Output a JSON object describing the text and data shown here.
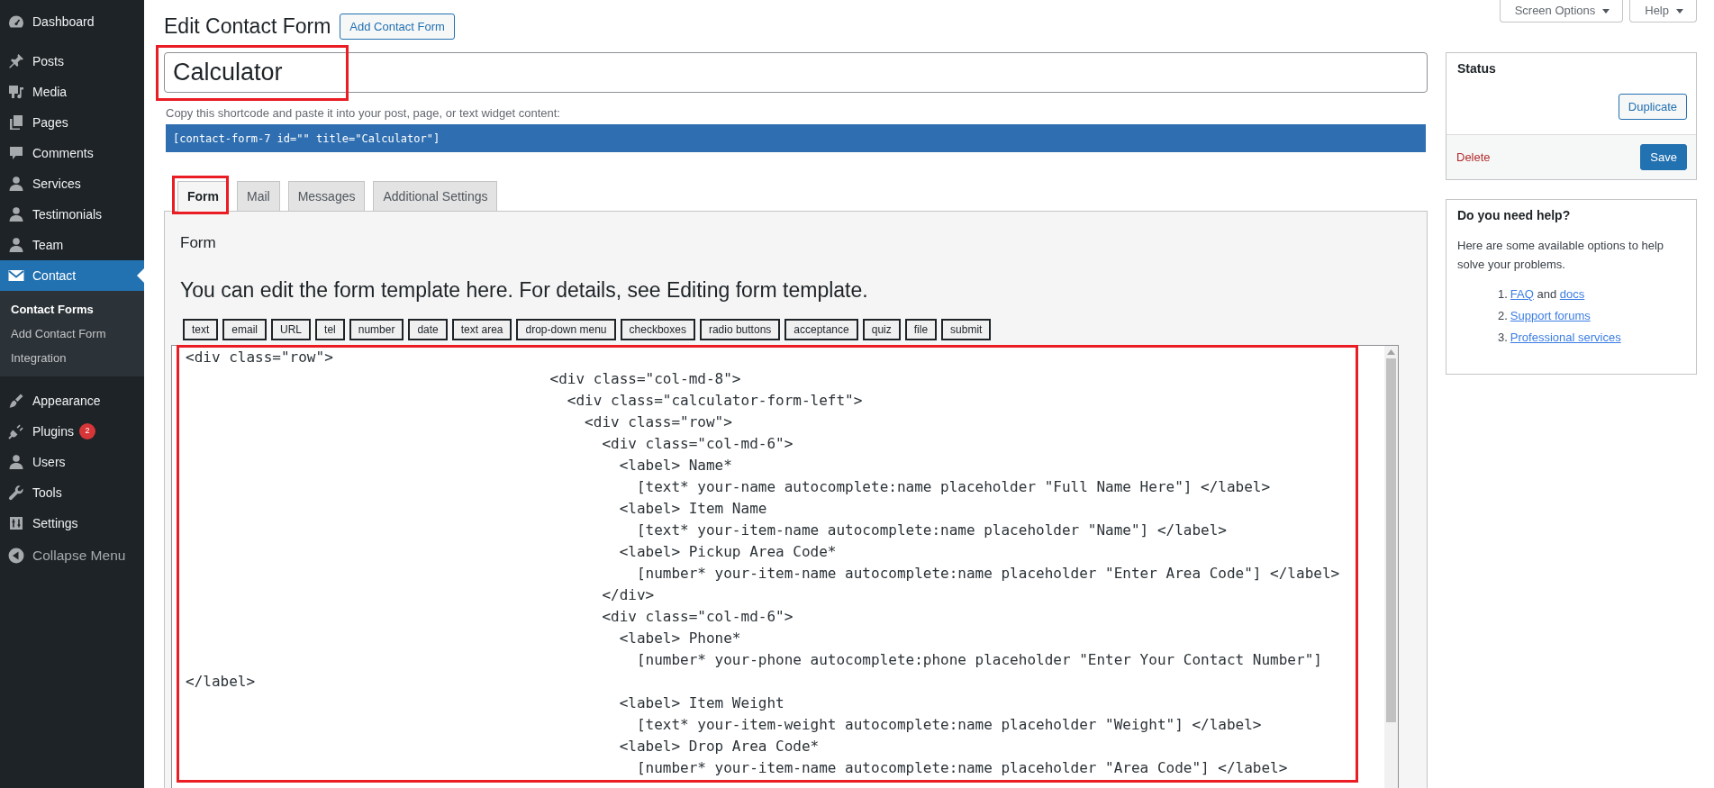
{
  "sidebar": {
    "sections": [
      {
        "items": [
          {
            "label": "Dashboard",
            "selected": false
          }
        ]
      },
      {
        "items": [
          {
            "label": "Posts",
            "selected": false
          },
          {
            "label": "Media",
            "selected": false
          },
          {
            "label": "Pages",
            "selected": false
          },
          {
            "label": "Comments",
            "selected": false
          },
          {
            "label": "Services",
            "selected": false
          },
          {
            "label": "Testimonials",
            "selected": false
          },
          {
            "label": "Team",
            "selected": false
          },
          {
            "label": "Contact",
            "selected": true,
            "children": [
              {
                "label": "Contact Forms",
                "selected": true
              },
              {
                "label": "Add Contact Form",
                "selected": false
              },
              {
                "label": "Integration",
                "selected": false
              }
            ]
          }
        ]
      },
      {
        "items": [
          {
            "label": "Appearance",
            "selected": false
          },
          {
            "label": "Plugins",
            "selected": false,
            "badge": "2"
          },
          {
            "label": "Users",
            "selected": false
          },
          {
            "label": "Tools",
            "selected": false
          },
          {
            "label": "Settings",
            "selected": false
          }
        ]
      }
    ],
    "collapse": "Collapse Menu"
  },
  "screen_meta": {
    "buttons": [
      "Screen Options",
      "Help"
    ]
  },
  "header": {
    "title": "Edit Contact Form",
    "action": "Add Contact Form"
  },
  "form_title": {
    "value": "Calculator",
    "highlighted": true
  },
  "shortcode": {
    "hint": "Copy this shortcode and paste it into your post, page, or text widget content:",
    "code": "[contact-form-7 id=\"\" title=\"Calculator\"]"
  },
  "tabs": [
    {
      "label": "Form",
      "selected": true,
      "highlighted": true
    },
    {
      "label": "Mail",
      "selected": false,
      "highlighted": false
    },
    {
      "label": "Messages",
      "selected": false,
      "highlighted": false
    },
    {
      "label": "Additional Settings",
      "selected": false,
      "highlighted": false
    }
  ],
  "panel": {
    "heading": "Form",
    "intro": {
      "before": "You can edit the form template here. For details, see ",
      "link": "Editing form template",
      "after": "."
    },
    "tag_buttons": [
      "text",
      "email",
      "URL",
      "tel",
      "number",
      "date",
      "text area",
      "drop-down menu",
      "checkboxes",
      "radio buttons",
      "acceptance",
      "quiz",
      "file",
      "submit"
    ]
  },
  "editor": {
    "highlighted": true,
    "lines": [
      "<div class=\"row\">",
      "                                          <div class=\"col-md-8\">",
      "                                            <div class=\"calculator-form-left\">",
      "                                              <div class=\"row\">",
      "                                                <div class=\"col-md-6\">",
      "                                                  <label> Name*",
      "                                                    [text* your-name autocomplete:name placeholder \"Full Name Here\"] </label>",
      "                                                  <label> Item Name",
      "                                                    [text* your-item-name autocomplete:name placeholder \"Name\"] </label>",
      "                                                  <label> Pickup Area Code*",
      "                                                    [number* your-item-name autocomplete:name placeholder \"Enter Area Code\"] </label>",
      "                                                </div>",
      "                                                <div class=\"col-md-6\">",
      "                                                  <label> Phone*",
      "                                                    [number* your-phone autocomplete:phone placeholder \"Enter Your Contact Number\"]",
      "</label>",
      "                                                  <label> Item Weight",
      "                                                    [text* your-item-weight autocomplete:name placeholder \"Weight\"] </label>",
      "                                                  <label> Drop Area Code*",
      "                                                    [number* your-item-name autocomplete:name placeholder \"Area Code\"] </label>"
    ]
  },
  "status_box": {
    "title": "Status",
    "duplicate": "Duplicate",
    "delete": "Delete",
    "save": "Save"
  },
  "help_box": {
    "title": "Do you need help?",
    "text": "Here are some available options to help solve your problems.",
    "items": [
      {
        "number": "1.",
        "parts": [
          {
            "kind": "link",
            "text": "FAQ"
          },
          {
            "kind": "text",
            "text": "and"
          },
          {
            "kind": "link",
            "text": "docs"
          }
        ]
      },
      {
        "number": "2.",
        "parts": [
          {
            "kind": "link",
            "text": "Support forums"
          }
        ]
      },
      {
        "number": "3.",
        "parts": [
          {
            "kind": "link",
            "text": "Professional services"
          }
        ]
      }
    ]
  }
}
